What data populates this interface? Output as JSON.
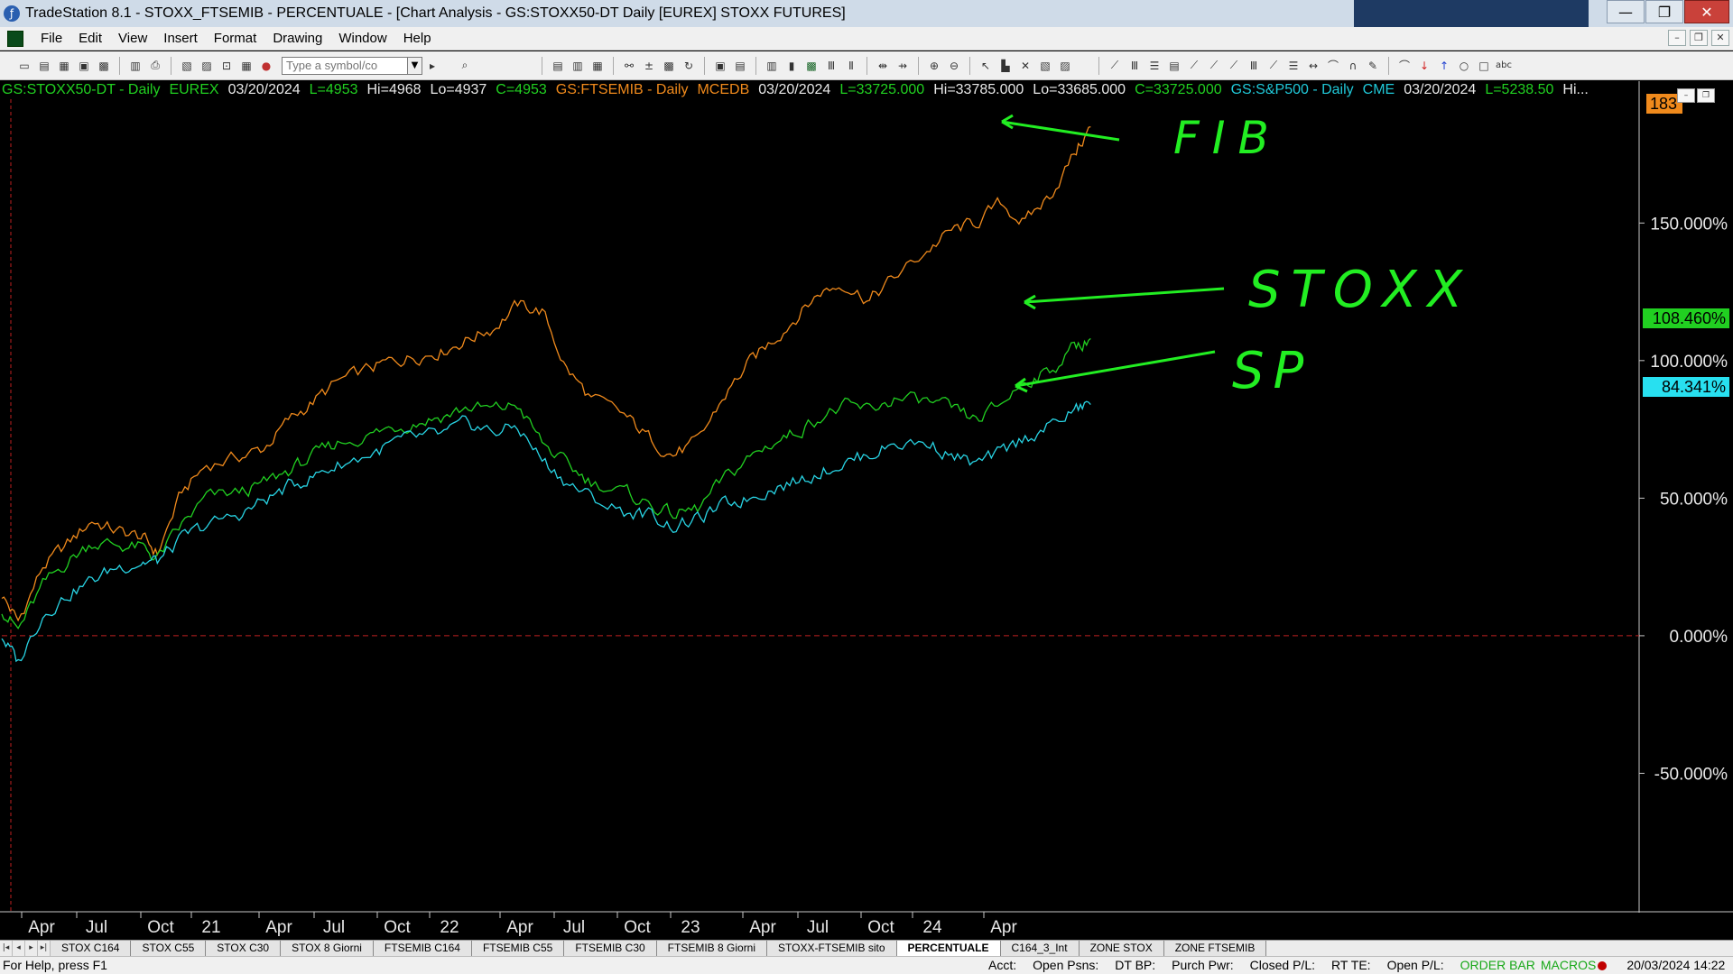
{
  "window": {
    "title": "TradeStation 8.1 - STOXX_FTSEMIB - PERCENTUALE - [Chart Analysis - GS:STOXX50-DT  Daily  [EUREX] STOXX FUTURES]"
  },
  "menu": [
    "File",
    "Edit",
    "View",
    "Insert",
    "Format",
    "Drawing",
    "Window",
    "Help"
  ],
  "toolbar": {
    "symbol_placeholder": "Type a symbol/co"
  },
  "status_line": [
    {
      "text": "GS:STOXX50-DT - Daily",
      "color": "green"
    },
    {
      "text": "EUREX",
      "color": "green"
    },
    {
      "text": "03/20/2024",
      "color": "white"
    },
    {
      "text": "L=4953",
      "color": "green"
    },
    {
      "text": "Hi=4968",
      "color": "white"
    },
    {
      "text": "Lo=4937",
      "color": "white"
    },
    {
      "text": "C=4953",
      "color": "green"
    },
    {
      "text": "GS:FTSEMIB - Daily",
      "color": "orange"
    },
    {
      "text": "MCEDB",
      "color": "orange"
    },
    {
      "text": "03/20/2024",
      "color": "white"
    },
    {
      "text": "L=33725.000",
      "color": "green"
    },
    {
      "text": "Hi=33785.000",
      "color": "white"
    },
    {
      "text": "Lo=33685.000",
      "color": "white"
    },
    {
      "text": "C=33725.000",
      "color": "green"
    },
    {
      "text": "GS:S&P500 - Daily",
      "color": "cyan"
    },
    {
      "text": "CME",
      "color": "cyan"
    },
    {
      "text": "03/20/2024",
      "color": "white"
    },
    {
      "text": "L=5238.50",
      "color": "green"
    },
    {
      "text": "Hi...",
      "color": "white"
    }
  ],
  "badges": {
    "orange": "183",
    "green": "108.460%",
    "cyan": "84.341%"
  },
  "annotations": {
    "fib": "FIB",
    "stoxx": "STOXX",
    "sp": "SP"
  },
  "colors": {
    "ftsemib": "#f08a1c",
    "stoxx": "#21d021",
    "sp500": "#28d4e4",
    "annotation": "#22ee22",
    "zero_line": "#c02020"
  },
  "chart_data": {
    "type": "line",
    "ylim": [
      -100,
      195
    ],
    "y_ticks": [
      "150.000%",
      "100.000%",
      "50.000%",
      "0.000%",
      "-50.000%"
    ],
    "y_tick_values": [
      150,
      100,
      50,
      0,
      -50
    ],
    "x_ticks": [
      "Apr",
      "Jul",
      "Oct",
      "21",
      "Apr",
      "Jul",
      "Oct",
      "22",
      "Apr",
      "Jul",
      "Oct",
      "23",
      "Apr",
      "Jul",
      "Oct",
      "24",
      "Apr"
    ],
    "series": [
      {
        "name": "GS:FTSEMIB - Daily",
        "color": "orange",
        "values": [
          [
            0,
            15
          ],
          [
            2,
            5
          ],
          [
            5,
            25
          ],
          [
            8,
            33
          ],
          [
            11,
            42
          ],
          [
            14,
            38
          ],
          [
            17,
            36
          ],
          [
            19,
            30
          ],
          [
            22,
            52
          ],
          [
            25,
            62
          ],
          [
            29,
            65
          ],
          [
            32,
            68
          ],
          [
            35,
            78
          ],
          [
            38,
            85
          ],
          [
            41,
            92
          ],
          [
            45,
            97
          ],
          [
            48,
            100
          ],
          [
            51,
            102
          ],
          [
            54,
            104
          ],
          [
            57,
            108
          ],
          [
            60,
            112
          ],
          [
            63,
            120
          ],
          [
            66,
            118
          ],
          [
            69,
            97
          ],
          [
            72,
            86
          ],
          [
            76,
            80
          ],
          [
            79,
            72
          ],
          [
            82,
            66
          ],
          [
            85,
            70
          ],
          [
            88,
            86
          ],
          [
            91,
            98
          ],
          [
            94,
            107
          ],
          [
            97,
            116
          ],
          [
            100,
            125
          ],
          [
            103,
            128
          ],
          [
            106,
            122
          ],
          [
            109,
            130
          ],
          [
            113,
            140
          ],
          [
            116,
            147
          ],
          [
            119,
            150
          ],
          [
            122,
            157
          ],
          [
            125,
            150
          ],
          [
            128,
            160
          ],
          [
            131,
            175
          ],
          [
            133,
            185
          ]
        ]
      },
      {
        "name": "GS:STOXX50-DT - Daily",
        "color": "green",
        "values": [
          [
            0,
            10
          ],
          [
            2,
            2
          ],
          [
            5,
            18
          ],
          [
            8,
            27
          ],
          [
            11,
            34
          ],
          [
            14,
            33
          ],
          [
            17,
            32
          ],
          [
            19,
            28
          ],
          [
            22,
            40
          ],
          [
            25,
            50
          ],
          [
            29,
            52
          ],
          [
            32,
            55
          ],
          [
            35,
            60
          ],
          [
            38,
            65
          ],
          [
            41,
            70
          ],
          [
            45,
            73
          ],
          [
            48,
            76
          ],
          [
            51,
            78
          ],
          [
            54,
            80
          ],
          [
            57,
            83
          ],
          [
            60,
            82
          ],
          [
            63,
            84
          ],
          [
            66,
            70
          ],
          [
            69,
            62
          ],
          [
            72,
            56
          ],
          [
            76,
            52
          ],
          [
            79,
            48
          ],
          [
            82,
            44
          ],
          [
            85,
            46
          ],
          [
            88,
            56
          ],
          [
            91,
            64
          ],
          [
            94,
            70
          ],
          [
            97,
            74
          ],
          [
            100,
            80
          ],
          [
            103,
            83
          ],
          [
            106,
            82
          ],
          [
            109,
            86
          ],
          [
            113,
            85
          ],
          [
            116,
            82
          ],
          [
            119,
            78
          ],
          [
            122,
            84
          ],
          [
            125,
            93
          ],
          [
            128,
            96
          ],
          [
            131,
            105
          ],
          [
            133,
            108
          ]
        ]
      },
      {
        "name": "GS:S&P500 - Daily",
        "color": "cyan",
        "values": [
          [
            0,
            0
          ],
          [
            2,
            -10
          ],
          [
            5,
            8
          ],
          [
            8,
            15
          ],
          [
            11,
            20
          ],
          [
            14,
            25
          ],
          [
            17,
            27
          ],
          [
            19,
            27
          ],
          [
            22,
            35
          ],
          [
            25,
            40
          ],
          [
            29,
            44
          ],
          [
            32,
            49
          ],
          [
            35,
            54
          ],
          [
            38,
            58
          ],
          [
            41,
            62
          ],
          [
            45,
            66
          ],
          [
            48,
            70
          ],
          [
            51,
            72
          ],
          [
            54,
            73
          ],
          [
            57,
            77
          ],
          [
            60,
            74
          ],
          [
            63,
            76
          ],
          [
            66,
            64
          ],
          [
            69,
            56
          ],
          [
            72,
            50
          ],
          [
            76,
            45
          ],
          [
            79,
            44
          ],
          [
            82,
            40
          ],
          [
            85,
            42
          ],
          [
            88,
            47
          ],
          [
            91,
            50
          ],
          [
            94,
            54
          ],
          [
            97,
            56
          ],
          [
            100,
            60
          ],
          [
            103,
            63
          ],
          [
            106,
            66
          ],
          [
            109,
            70
          ],
          [
            113,
            70
          ],
          [
            116,
            66
          ],
          [
            119,
            62
          ],
          [
            122,
            66
          ],
          [
            125,
            72
          ],
          [
            128,
            76
          ],
          [
            131,
            82
          ],
          [
            133,
            84
          ]
        ]
      }
    ]
  },
  "tabs": [
    "STOX C164",
    "STOX C55",
    "STOX  C30",
    "STOX  8 Giorni",
    "FTSEMIB C164",
    "FTSEMIB C55",
    "FTSEMIB C30",
    "FTSEMIB  8 Giorni",
    "STOXX-FTSEMIB sito",
    "PERCENTUALE",
    "C164_3_Int",
    "ZONE STOX",
    "ZONE FTSEMIB"
  ],
  "active_tab": "PERCENTUALE",
  "statusbar": {
    "help": "For Help, press F1",
    "acct": "Acct:",
    "open_psns": "Open Psns:",
    "dt_bp": "DT BP:",
    "purch_pwr": "Purch Pwr:",
    "closed_pl": "Closed P/L:",
    "rt_te": "RT TE:",
    "open_pl": "Open P/L:",
    "orderbar": "ORDER BAR",
    "macros": "MACROS",
    "datetime": "20/03/2024 14:22"
  }
}
